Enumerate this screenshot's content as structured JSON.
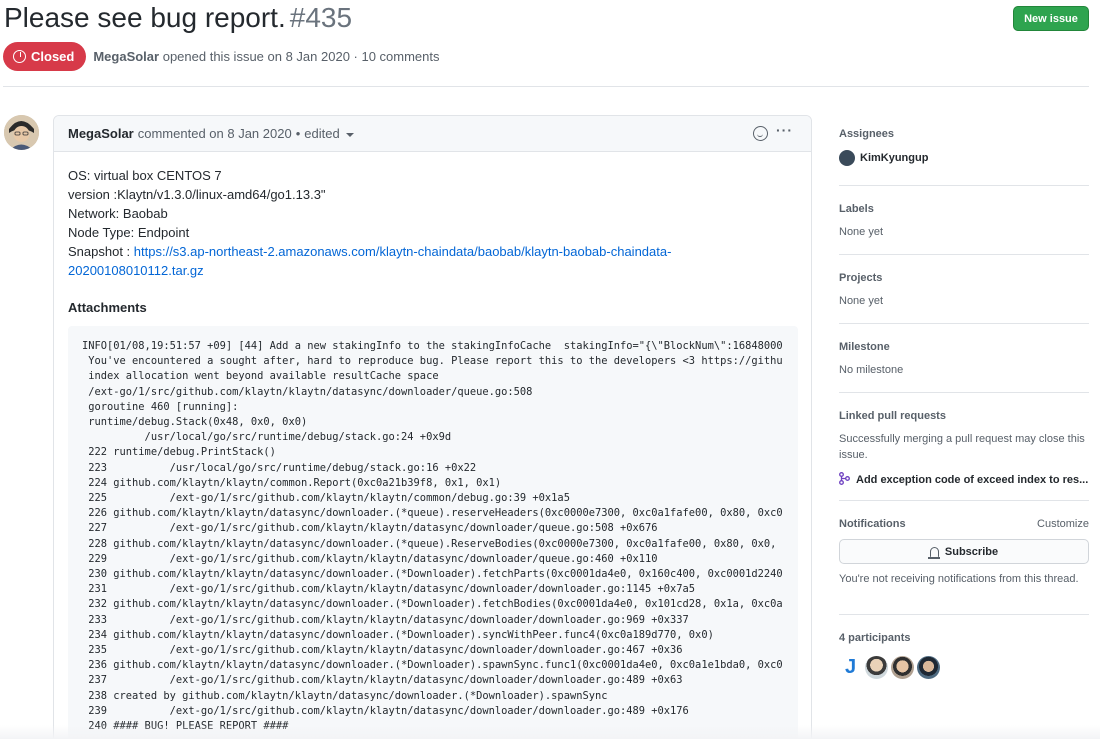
{
  "issue": {
    "title": "Please see bug report.",
    "number": "#435",
    "state": "Closed",
    "author": "MegaSolar",
    "meta_suffix": "opened this issue on 8 Jan 2020 · 10 comments",
    "new_issue_label": "New issue"
  },
  "comment": {
    "author": "MegaSolar",
    "action": "commented on 8 Jan 2020",
    "edited": "edited",
    "lines": [
      "OS: virtual box CENTOS 7",
      "version :Klaytn/v1.3.0/linux-amd64/go1.13.3\"",
      "Network: Baobab",
      "Node Type: Endpoint"
    ],
    "snapshot_label": "Snapshot : ",
    "snapshot_link_1": "https://s3.ap-northeast-2.amazonaws.com/klaytn-chaindata/baobab/klaytn-baobab-chaindata-",
    "snapshot_link_2": "20200108010112.tar.gz",
    "attachments_label": "Attachments",
    "code": "INFO[01/08,19:51:57 +09] [44] Add a new stakingInfo to the stakingInfoCache  stakingInfo=\"{\\\"BlockNum\\\":16848000\n You've encountered a sought after, hard to reproduce bug. Please report this to the developers <3 https://githu\n index allocation went beyond available resultCache space\n /ext-go/1/src/github.com/klaytn/klaytn/datasync/downloader/queue.go:508\n goroutine 460 [running]:\n runtime/debug.Stack(0x48, 0x0, 0x0)\n          /usr/local/go/src/runtime/debug/stack.go:24 +0x9d\n 222 runtime/debug.PrintStack()\n 223          /usr/local/go/src/runtime/debug/stack.go:16 +0x22\n 224 github.com/klaytn/klaytn/common.Report(0xc0a21b39f8, 0x1, 0x1)\n 225          /ext-go/1/src/github.com/klaytn/klaytn/common/debug.go:39 +0x1a5\n 226 github.com/klaytn/klaytn/datasync/downloader.(*queue).reserveHeaders(0xc0000e7300, 0xc0a1fafe00, 0x80, 0xc0\n 227          /ext-go/1/src/github.com/klaytn/klaytn/datasync/downloader/queue.go:508 +0x676\n 228 github.com/klaytn/klaytn/datasync/downloader.(*queue).ReserveBodies(0xc0000e7300, 0xc0a1fafe00, 0x80, 0x0,\n 229          /ext-go/1/src/github.com/klaytn/klaytn/datasync/downloader/queue.go:460 +0x110\n 230 github.com/klaytn/klaytn/datasync/downloader.(*Downloader).fetchParts(0xc0001da4e0, 0x160c400, 0xc0001d2240\n 231          /ext-go/1/src/github.com/klaytn/klaytn/datasync/downloader/downloader.go:1145 +0x7a5\n 232 github.com/klaytn/klaytn/datasync/downloader.(*Downloader).fetchBodies(0xc0001da4e0, 0x101cd28, 0x1a, 0xc0a\n 233          /ext-go/1/src/github.com/klaytn/klaytn/datasync/downloader/downloader.go:969 +0x337\n 234 github.com/klaytn/klaytn/datasync/downloader.(*Downloader).syncWithPeer.func4(0xc0a189d770, 0x0)\n 235          /ext-go/1/src/github.com/klaytn/klaytn/datasync/downloader/downloader.go:467 +0x36\n 236 github.com/klaytn/klaytn/datasync/downloader.(*Downloader).spawnSync.func1(0xc0001da4e0, 0xc0a1e1bda0, 0xc0\n 237          /ext-go/1/src/github.com/klaytn/klaytn/datasync/downloader/downloader.go:489 +0x63\n 238 created by github.com/klaytn/klaytn/datasync/downloader.(*Downloader).spawnSync\n 239          /ext-go/1/src/github.com/klaytn/klaytn/datasync/downloader/downloader.go:489 +0x176\n 240 #### BUG! PLEASE REPORT ####"
  },
  "sidebar": {
    "assignees_title": "Assignees",
    "assignee_name": "KimKyungup",
    "labels_title": "Labels",
    "labels_value": "None yet",
    "projects_title": "Projects",
    "projects_value": "None yet",
    "milestone_title": "Milestone",
    "milestone_value": "No milestone",
    "linked_title": "Linked pull requests",
    "linked_desc": "Successfully merging a pull request may close this issue.",
    "linked_pr": "Add exception code of exceed index to res...",
    "notifications_title": "Notifications",
    "customize_label": "Customize",
    "subscribe_label": "Subscribe",
    "notif_desc": "You're not receiving notifications from this thread.",
    "participants_title": "4 participants",
    "participant_letter": "J"
  },
  "colors": {
    "closed_red": "#d73a49",
    "green": "#2ea44f",
    "link_blue": "#0366d6"
  }
}
